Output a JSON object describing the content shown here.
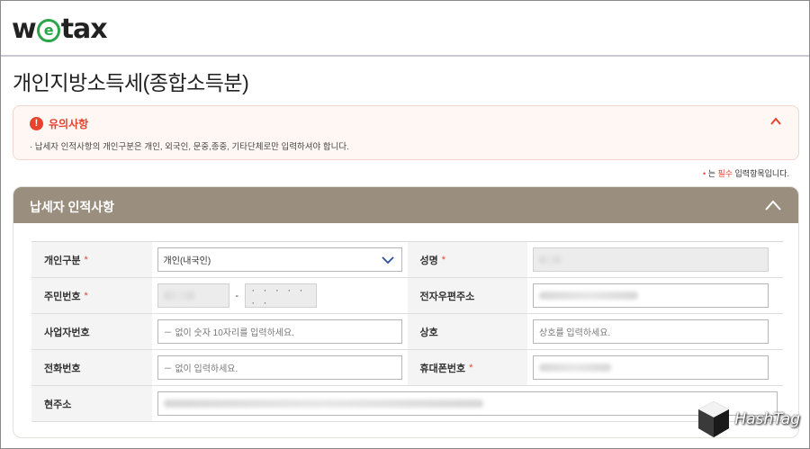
{
  "app": {
    "logo_prefix": "w",
    "logo_e": "e",
    "logo_suffix": "tax"
  },
  "page_title": "개인지방소득세(종합소득분)",
  "notice": {
    "title": "유의사항",
    "text": "· 납세자 인적사항의 개인구분은 개인, 외국인, 문중,종중, 기타단체로만 입력하셔야 합니다."
  },
  "required_note": {
    "dot": "•",
    "prefix": " 는 ",
    "highlight": "필수",
    "suffix": " 입력항목입니다."
  },
  "panel": {
    "title": "납세자 인적사항"
  },
  "form": {
    "person_type_label": "개인구분",
    "person_type_value": "개인(내국인)",
    "name_label": "성명",
    "resident_no_label": "주민번호",
    "resident_no_mask": "· · · · · · ·",
    "resident_no_dash": "-",
    "email_label": "전자우편주소",
    "business_no_label": "사업자번호",
    "business_no_placeholder": "－ 없이 숫자 10자리를 입력하세요.",
    "company_label": "상호",
    "company_placeholder": "상호를 입력하세요.",
    "phone_label": "전화번호",
    "phone_placeholder": "－ 없이 입력하세요.",
    "mobile_label": "휴대폰번호",
    "address_label": "현주소",
    "required_mark": "*"
  },
  "watermark": {
    "text": "HashTag"
  },
  "colors": {
    "accent_red": "#e8432c",
    "panel_header": "#9a8f7e",
    "logo_green": "#2aa64a"
  }
}
